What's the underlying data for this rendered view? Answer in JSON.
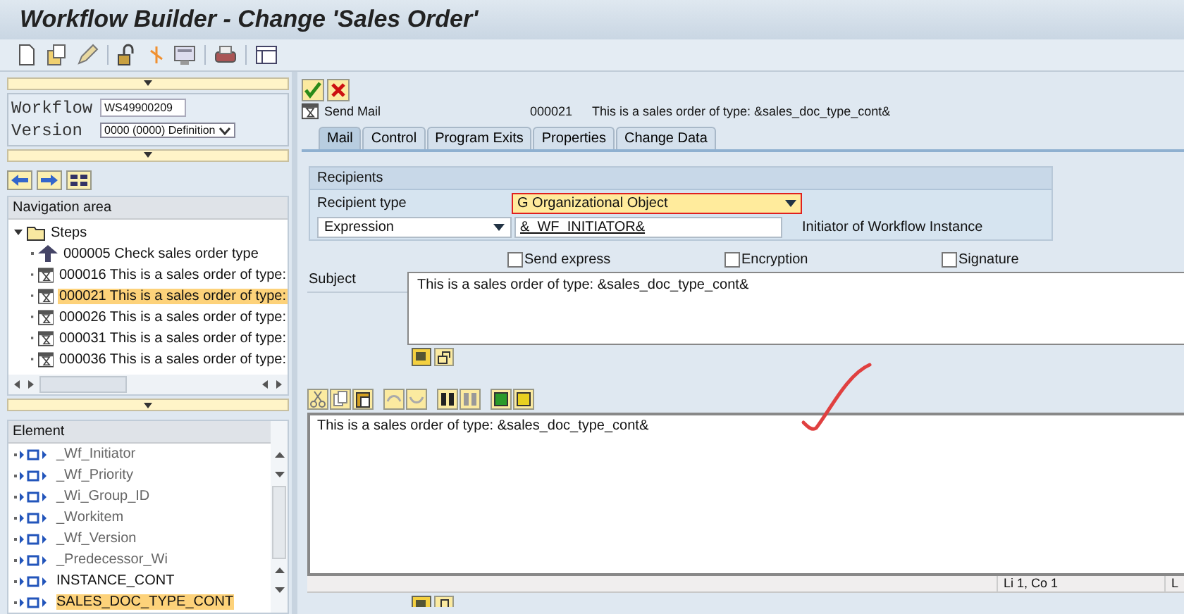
{
  "window": {
    "title": "Workflow Builder - Change 'Sales Order'"
  },
  "workflow_header": {
    "workflow_label": "Workflow",
    "workflow_value": "WS49900209",
    "version_label": "Version",
    "version_value": "0000 (0000) Definition"
  },
  "navigation": {
    "title": "Navigation area",
    "root": {
      "label": "Steps",
      "expanded": true,
      "children": [
        {
          "label": "000005 Check sales order type",
          "kind": "condition",
          "selected": false
        },
        {
          "label": "000016 This is a sales order of type:",
          "kind": "mail",
          "selected": false
        },
        {
          "label": "000021 This is a sales order of type:",
          "kind": "mail",
          "selected": true
        },
        {
          "label": "000026 This is a sales order of type:",
          "kind": "mail",
          "selected": false
        },
        {
          "label": "000031 This is a sales order of type:",
          "kind": "mail",
          "selected": false
        },
        {
          "label": "000036 This is a sales order of type:",
          "kind": "mail",
          "selected": false
        }
      ]
    }
  },
  "elements": {
    "title": "Element",
    "items": [
      {
        "label": "_Wf_Initiator",
        "kind": "system",
        "selected": false
      },
      {
        "label": "_Wf_Priority",
        "kind": "system",
        "selected": false
      },
      {
        "label": "_Wi_Group_ID",
        "kind": "system",
        "selected": false
      },
      {
        "label": "_Workitem",
        "kind": "system",
        "selected": false
      },
      {
        "label": "_Wf_Version",
        "kind": "system",
        "selected": false
      },
      {
        "label": "_Predecessor_Wi",
        "kind": "system",
        "selected": false
      },
      {
        "label": "INSTANCE_CONT",
        "kind": "user",
        "selected": false
      },
      {
        "label": "SALES_DOC_TYPE_CONT",
        "kind": "user",
        "selected": true
      }
    ]
  },
  "step": {
    "type": "Send Mail",
    "number": "000021",
    "description": "This is a sales order of type: &sales_doc_type_cont&"
  },
  "tabs": [
    {
      "label": "Mail",
      "selected": true
    },
    {
      "label": "Control",
      "selected": false
    },
    {
      "label": "Program Exits",
      "selected": false
    },
    {
      "label": "Properties",
      "selected": false
    },
    {
      "label": "Change Data",
      "selected": false
    }
  ],
  "recipients": {
    "title": "Recipients",
    "type_label": "Recipient type",
    "type_value": "G Organizational Object",
    "expression_value": "Expression",
    "expression_field": "&_WF_INITIATOR&",
    "expression_text": "Initiator of Workflow Instance"
  },
  "options": [
    {
      "label": "Send express",
      "checked": false
    },
    {
      "label": "Encryption",
      "checked": false
    },
    {
      "label": "Signature",
      "checked": false
    }
  ],
  "subject": {
    "label": "Subject",
    "value": "This is a sales order of type: &sales_doc_type_cont&"
  },
  "body": {
    "value": "This is a sales order of type: &sales_doc_type_cont&"
  },
  "status": [
    "Li 1, Co 1",
    "L"
  ]
}
